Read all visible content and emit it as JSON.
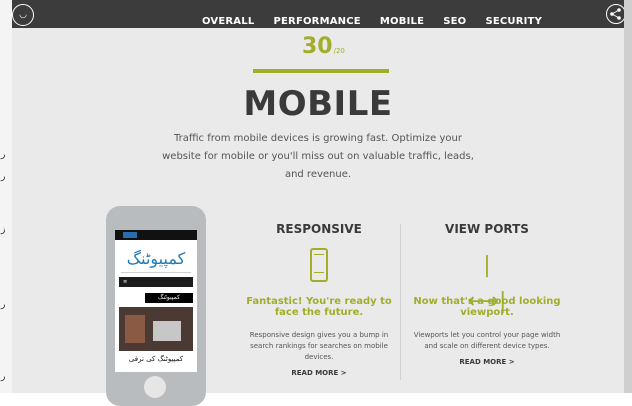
{
  "nav": {
    "links": [
      "OVERALL",
      "PERFORMANCE",
      "MOBILE",
      "SEO",
      "SECURITY"
    ]
  },
  "score": {
    "value": "30",
    "max": "/20"
  },
  "section": {
    "title": "MOBILE",
    "description": "Traffic from mobile devices is growing fast. Optimize your website for mobile or you'll miss out on valuable traffic, leads, and revenue."
  },
  "responsive": {
    "title": "RESPONSIVE",
    "headline": "Fantastic! You're ready to face the future.",
    "body": "Responsive design gives you a bump in search rankings for searches on mobile devices.",
    "link": "READ MORE >"
  },
  "viewports": {
    "title": "VIEW PORTS",
    "headline": "Now that's a good looking viewport.",
    "body": "Viewports let you control your page width and scale on different device types.",
    "link": "READ MORE >"
  },
  "phone_preview": {
    "logo_text": "کمپیوٹنگ",
    "menu_label": "کمپیوٹنگ",
    "footer_text": "کمپیوٹنگ کی ترقی"
  },
  "colors": {
    "accent": "#a2ad2a",
    "nav_bg": "#3c3c3c",
    "panel_bg": "#eaeaea",
    "title": "#3a3a3a"
  },
  "icons": [
    "logo-icon",
    "share-icon",
    "phone-icon",
    "viewport-arrows-icon"
  ]
}
